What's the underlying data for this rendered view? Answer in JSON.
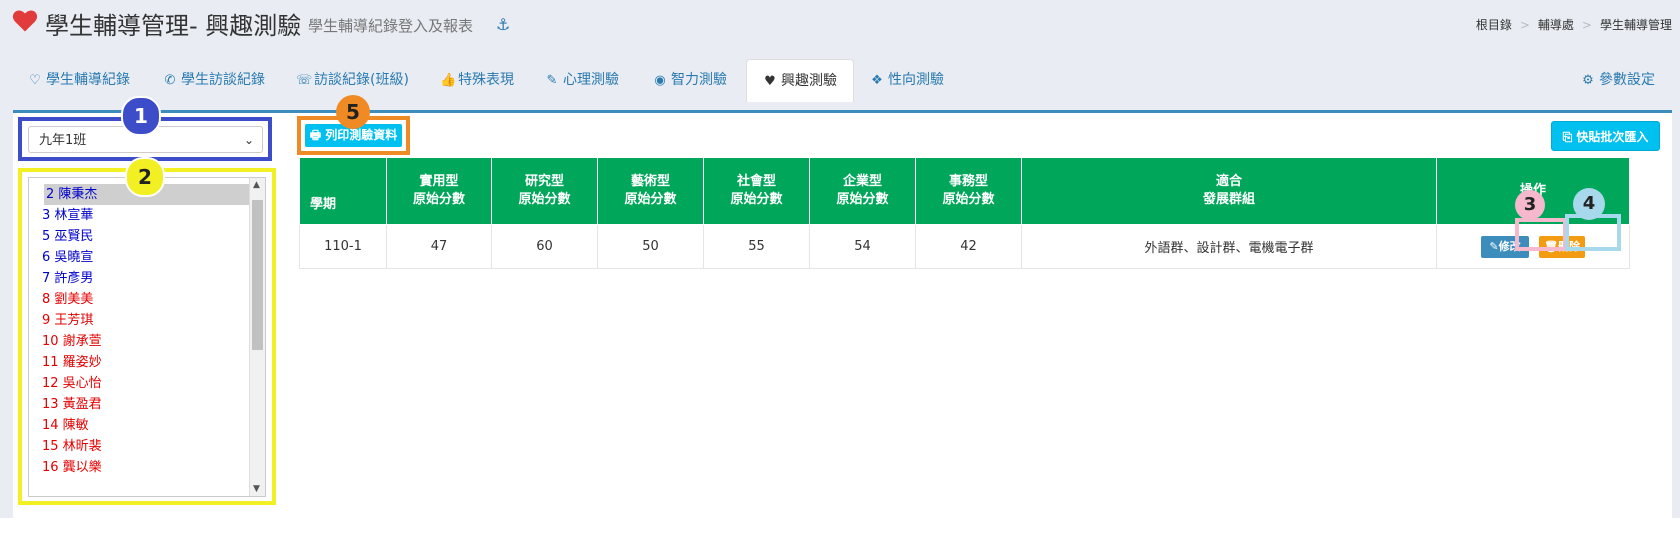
{
  "header": {
    "title": "學生輔導管理- 興趣測驗",
    "subtitle": "學生輔導紀錄登入及報表",
    "breadcrumbs": [
      "根目錄",
      "輔導處",
      "學生輔導管理"
    ]
  },
  "tabs": [
    {
      "label": "學生輔導紀錄",
      "icon": "heart-outline-icon"
    },
    {
      "label": "學生訪談紀錄",
      "icon": "phone-icon"
    },
    {
      "label": "訪談紀錄(班級)",
      "icon": "phone-ring-icon"
    },
    {
      "label": "特殊表現",
      "icon": "thumbs-up-icon"
    },
    {
      "label": "心理測驗",
      "icon": "edit-icon"
    },
    {
      "label": "智力測驗",
      "icon": "eye-icon"
    },
    {
      "label": "興趣測驗",
      "icon": "heartbeat-icon"
    },
    {
      "label": "性向測驗",
      "icon": "cubes-icon"
    },
    {
      "label": "參數設定",
      "icon": "gear-icon"
    }
  ],
  "class_select": {
    "value": "九年1班"
  },
  "students": [
    {
      "label": "2 陳秉杰",
      "color": "#0000cc"
    },
    {
      "label": "3 林宣華",
      "color": "#0000cc"
    },
    {
      "label": "5 巫賢民",
      "color": "#0000cc"
    },
    {
      "label": "6 吳曉宣",
      "color": "#0000cc"
    },
    {
      "label": "7 許彥男",
      "color": "#0000cc"
    },
    {
      "label": "8 劉美美",
      "color": "#e60000"
    },
    {
      "label": "9 王芳琪",
      "color": "#e60000"
    },
    {
      "label": "10 謝承萱",
      "color": "#e60000"
    },
    {
      "label": "11 羅姿妙",
      "color": "#e60000"
    },
    {
      "label": "12 吳心怡",
      "color": "#e60000"
    },
    {
      "label": "13 黃盈君",
      "color": "#e60000"
    },
    {
      "label": "14 陳敏",
      "color": "#e60000"
    },
    {
      "label": "15 林昕裴",
      "color": "#e60000"
    },
    {
      "label": "16 龔以樂",
      "color": "#e60000"
    }
  ],
  "buttons": {
    "print": "列印測驗資料",
    "paste": "快貼批次匯入",
    "edit": "修改",
    "delete": "刪除"
  },
  "badges": [
    "1",
    "2",
    "3",
    "4",
    "5"
  ],
  "table": {
    "headers": [
      {
        "line1": "學期",
        "line2": ""
      },
      {
        "line1": "實用型",
        "line2": "原始分數"
      },
      {
        "line1": "研究型",
        "line2": "原始分數"
      },
      {
        "line1": "藝術型",
        "line2": "原始分數"
      },
      {
        "line1": "社會型",
        "line2": "原始分數"
      },
      {
        "line1": "企業型",
        "line2": "原始分數"
      },
      {
        "line1": "事務型",
        "line2": "原始分數"
      },
      {
        "line1": "適合",
        "line2": "發展群組"
      },
      {
        "line1": "操作",
        "line2": ""
      }
    ],
    "rows": [
      {
        "term": "110-1",
        "practical": "47",
        "research": "60",
        "art": "50",
        "social": "55",
        "enterprise": "54",
        "affairs": "42",
        "group": "外語群、設計群、電機電子群"
      }
    ]
  },
  "colors": {
    "accent": "#3c8dbc",
    "table_header": "#00a65a",
    "info_button": "#00c0ef",
    "warning_button": "#f39c12"
  }
}
